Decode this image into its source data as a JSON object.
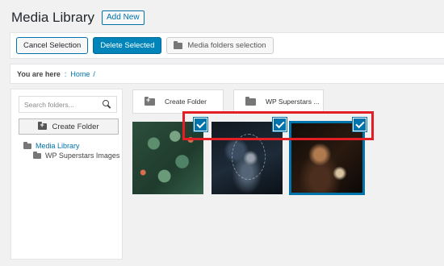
{
  "header": {
    "title": "Media Library",
    "add_new": "Add New"
  },
  "toolbar": {
    "cancel_selection": "Cancel Selection",
    "delete_selected": "Delete Selected",
    "media_folders_selection": "Media folders selection"
  },
  "breadcrumb": {
    "label": "You are here",
    "separator": ":",
    "home": "Home",
    "trail": "/"
  },
  "sidebar": {
    "search_placeholder": "Search folders...",
    "create_folder": "Create Folder",
    "tree": [
      {
        "label": "Media Library",
        "icon": "folder-icon"
      },
      {
        "label": "WP Superstars Images",
        "icon": "folder-icon"
      }
    ]
  },
  "folders": [
    {
      "label": "Create Folder",
      "icon": "folder-plus-icon"
    },
    {
      "label": "WP Superstars ...",
      "icon": "folder-icon"
    }
  ],
  "colors": {
    "accent": "#0073aa",
    "primary_button": "#0085ba",
    "highlight": "#e31e24"
  },
  "media": [
    {
      "selected": true,
      "icon": "check-icon"
    },
    {
      "selected": true,
      "icon": "check-icon"
    },
    {
      "selected": true,
      "icon": "check-icon"
    }
  ]
}
